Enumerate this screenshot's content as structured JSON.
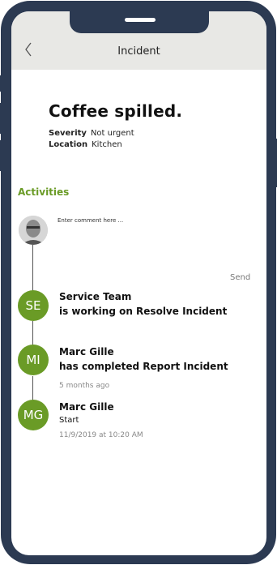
{
  "header": {
    "title": "Incident",
    "back_icon": "chevron-left-icon"
  },
  "incident": {
    "title": "Coffee spilled.",
    "severity_label": "Severity",
    "severity_value": "Not urgent",
    "location_label": "Location",
    "location_value": "Kitchen"
  },
  "activities": {
    "heading": "Activities",
    "comment_placeholder": "Enter comment here ...",
    "send_label": "Send",
    "items": [
      {
        "initials": "SE",
        "name": "Service Team",
        "text": "is working on Resolve Incident",
        "time": ""
      },
      {
        "initials": "MI",
        "name": "Marc Gille",
        "text": "has completed Report Incident",
        "time": "5 months ago"
      },
      {
        "initials": "MG",
        "name": "Marc Gille",
        "text": "Start",
        "time": "11/9/2019 at 10:20 AM"
      }
    ]
  },
  "colors": {
    "accent": "#6a9b26",
    "frame": "#2c3a52",
    "header_bg": "#e8e8e5"
  }
}
